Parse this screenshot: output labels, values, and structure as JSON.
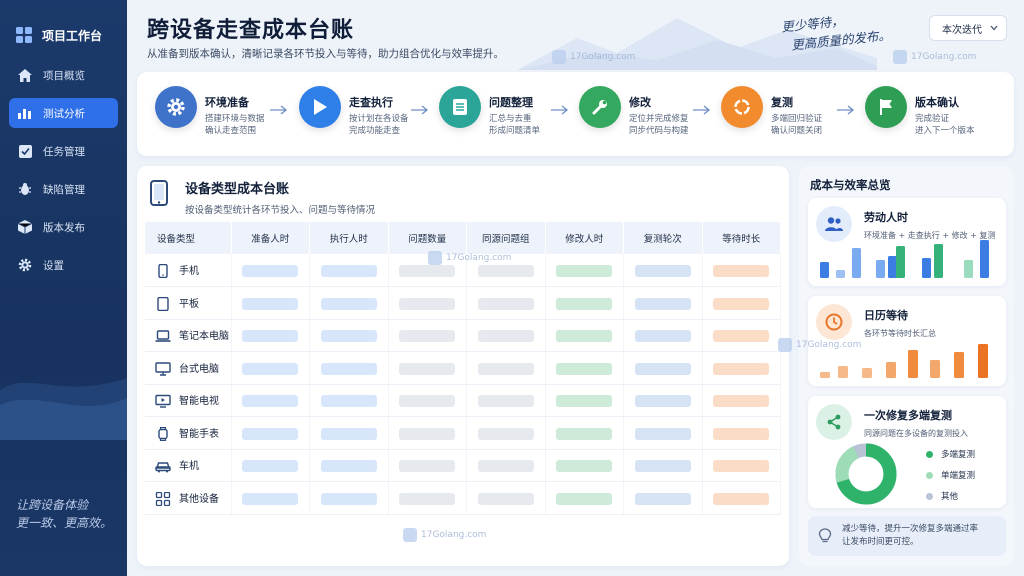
{
  "sidebar": {
    "brand": "项目工作台",
    "items": [
      {
        "label": "项目概览",
        "icon": "home-icon"
      },
      {
        "label": "测试分析",
        "icon": "bar-chart-icon",
        "active": true
      },
      {
        "label": "任务管理",
        "icon": "checklist-icon"
      },
      {
        "label": "缺陷管理",
        "icon": "bug-icon"
      },
      {
        "label": "版本发布",
        "icon": "package-icon"
      },
      {
        "label": "设置",
        "icon": "gear-icon"
      }
    ],
    "slogan_line1": "让跨设备体验",
    "slogan_line2": "更一致、更高效。"
  },
  "header": {
    "title": "跨设备走查成本台账",
    "subtitle": "从准备到版本确认，清晰记录各环节投入与等待，助力组合优化与效率提升。",
    "hand_line1": "更少等待，",
    "hand_line2": "更高质量的发布。",
    "version_select": "本次迭代"
  },
  "workflow": [
    {
      "title": "环境准备",
      "desc": "搭建环境与数据\n确认走查范围",
      "icon": "gear-icon",
      "color": "#3f73c9"
    },
    {
      "title": "走查执行",
      "desc": "按计划在各设备\n完成功能走查",
      "icon": "play-icon",
      "color": "#2f7fe8"
    },
    {
      "title": "问题整理",
      "desc": "汇总与去重\n形成问题清单",
      "icon": "document-icon",
      "color": "#2aa597"
    },
    {
      "title": "修改",
      "desc": "定位并完成修复\n同步代码与构建",
      "icon": "wrench-icon",
      "color": "#33a85e"
    },
    {
      "title": "复测",
      "desc": "多端回归验证\n确认问题关闭",
      "icon": "refresh-icon",
      "color": "#f28a2e"
    },
    {
      "title": "版本确认",
      "desc": "完成验证\n进入下一个版本",
      "icon": "flag-icon",
      "color": "#2e9e55"
    }
  ],
  "ledger": {
    "title": "设备类型成本台账",
    "subtitle": "按设备类型统计各环节投入、问题与等待情况",
    "columns": [
      "设备类型",
      "准备人时",
      "执行人时",
      "问题数量",
      "同源问题组",
      "修改人时",
      "复测轮次",
      "等待时长"
    ],
    "rows": [
      {
        "label": "手机",
        "icon": "phone-icon"
      },
      {
        "label": "平板",
        "icon": "tablet-icon"
      },
      {
        "label": "笔记本电脑",
        "icon": "laptop-icon"
      },
      {
        "label": "台式电脑",
        "icon": "desktop-icon"
      },
      {
        "label": "智能电视",
        "icon": "tv-icon"
      },
      {
        "label": "智能手表",
        "icon": "watch-icon"
      },
      {
        "label": "车机",
        "icon": "car-icon"
      },
      {
        "label": "其他设备",
        "icon": "grid-icon"
      }
    ]
  },
  "summary": {
    "title": "成本与效率总览",
    "labor": {
      "title": "劳动人时",
      "desc": "环境准备 + 走查执行 + 修改 + 复测"
    },
    "calendar": {
      "title": "日历等待",
      "desc": "各环节等待时长汇总"
    },
    "multi": {
      "title": "一次修复多端复测",
      "desc": "同源问题在多设备的复测投入",
      "legend": [
        {
          "label": "多端复测",
          "color": "#2fb36a"
        },
        {
          "label": "单端复测",
          "color": "#9ddcb7"
        },
        {
          "label": "其他",
          "color": "#b8c3d6"
        }
      ]
    },
    "tip": "减少等待，提升一次修复多端通过率\n让发布时间更可控。"
  },
  "colors": {
    "accent": "#2f6fe8",
    "sidebar": "#1b3a6b",
    "green": "#2fb36a",
    "orange": "#f28a2e"
  },
  "watermark": "17Golang.com"
}
